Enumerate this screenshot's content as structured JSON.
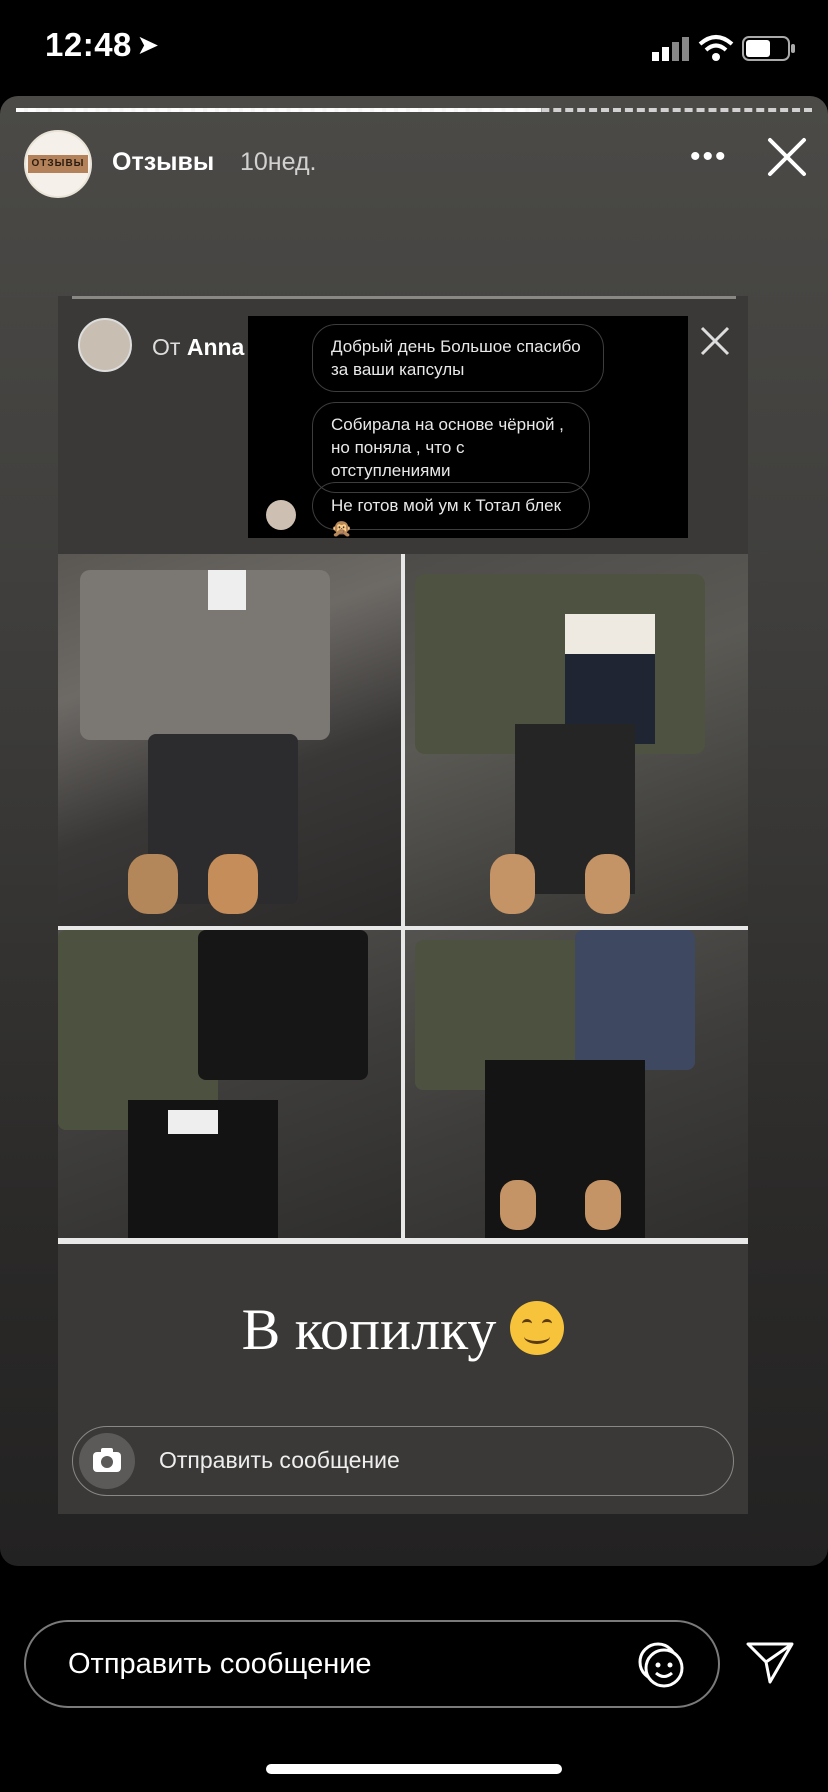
{
  "status_bar": {
    "time": "12:48",
    "battery_level": 0.6
  },
  "story": {
    "progress_fraction": 0.66,
    "username": "Отзывы",
    "avatar_text": "ОТЗЫВЫ",
    "age": "10нед.",
    "repost": {
      "from_prefix": "От",
      "from_name": "Anna",
      "messages": [
        "Добрый день Большое спасибо за ваши капсулы",
        "Собирала на основе чёрной , но поняла , что с отступлениями",
        "Не готов мой ум к Тотал блек 🙊"
      ],
      "caption": "В копилку",
      "input_placeholder": "Отправить сообщение"
    }
  },
  "reply_bar": {
    "placeholder": "Отправить сообщение"
  },
  "icons": [
    "location-arrow-icon",
    "signal-icon",
    "wifi-icon",
    "battery-icon",
    "more-icon",
    "close-icon",
    "camera-icon",
    "sticker-icon",
    "send-icon"
  ],
  "colors": {
    "background": "#000000",
    "story_bg": "#3f3e3c",
    "border": "#7a7a7a"
  }
}
